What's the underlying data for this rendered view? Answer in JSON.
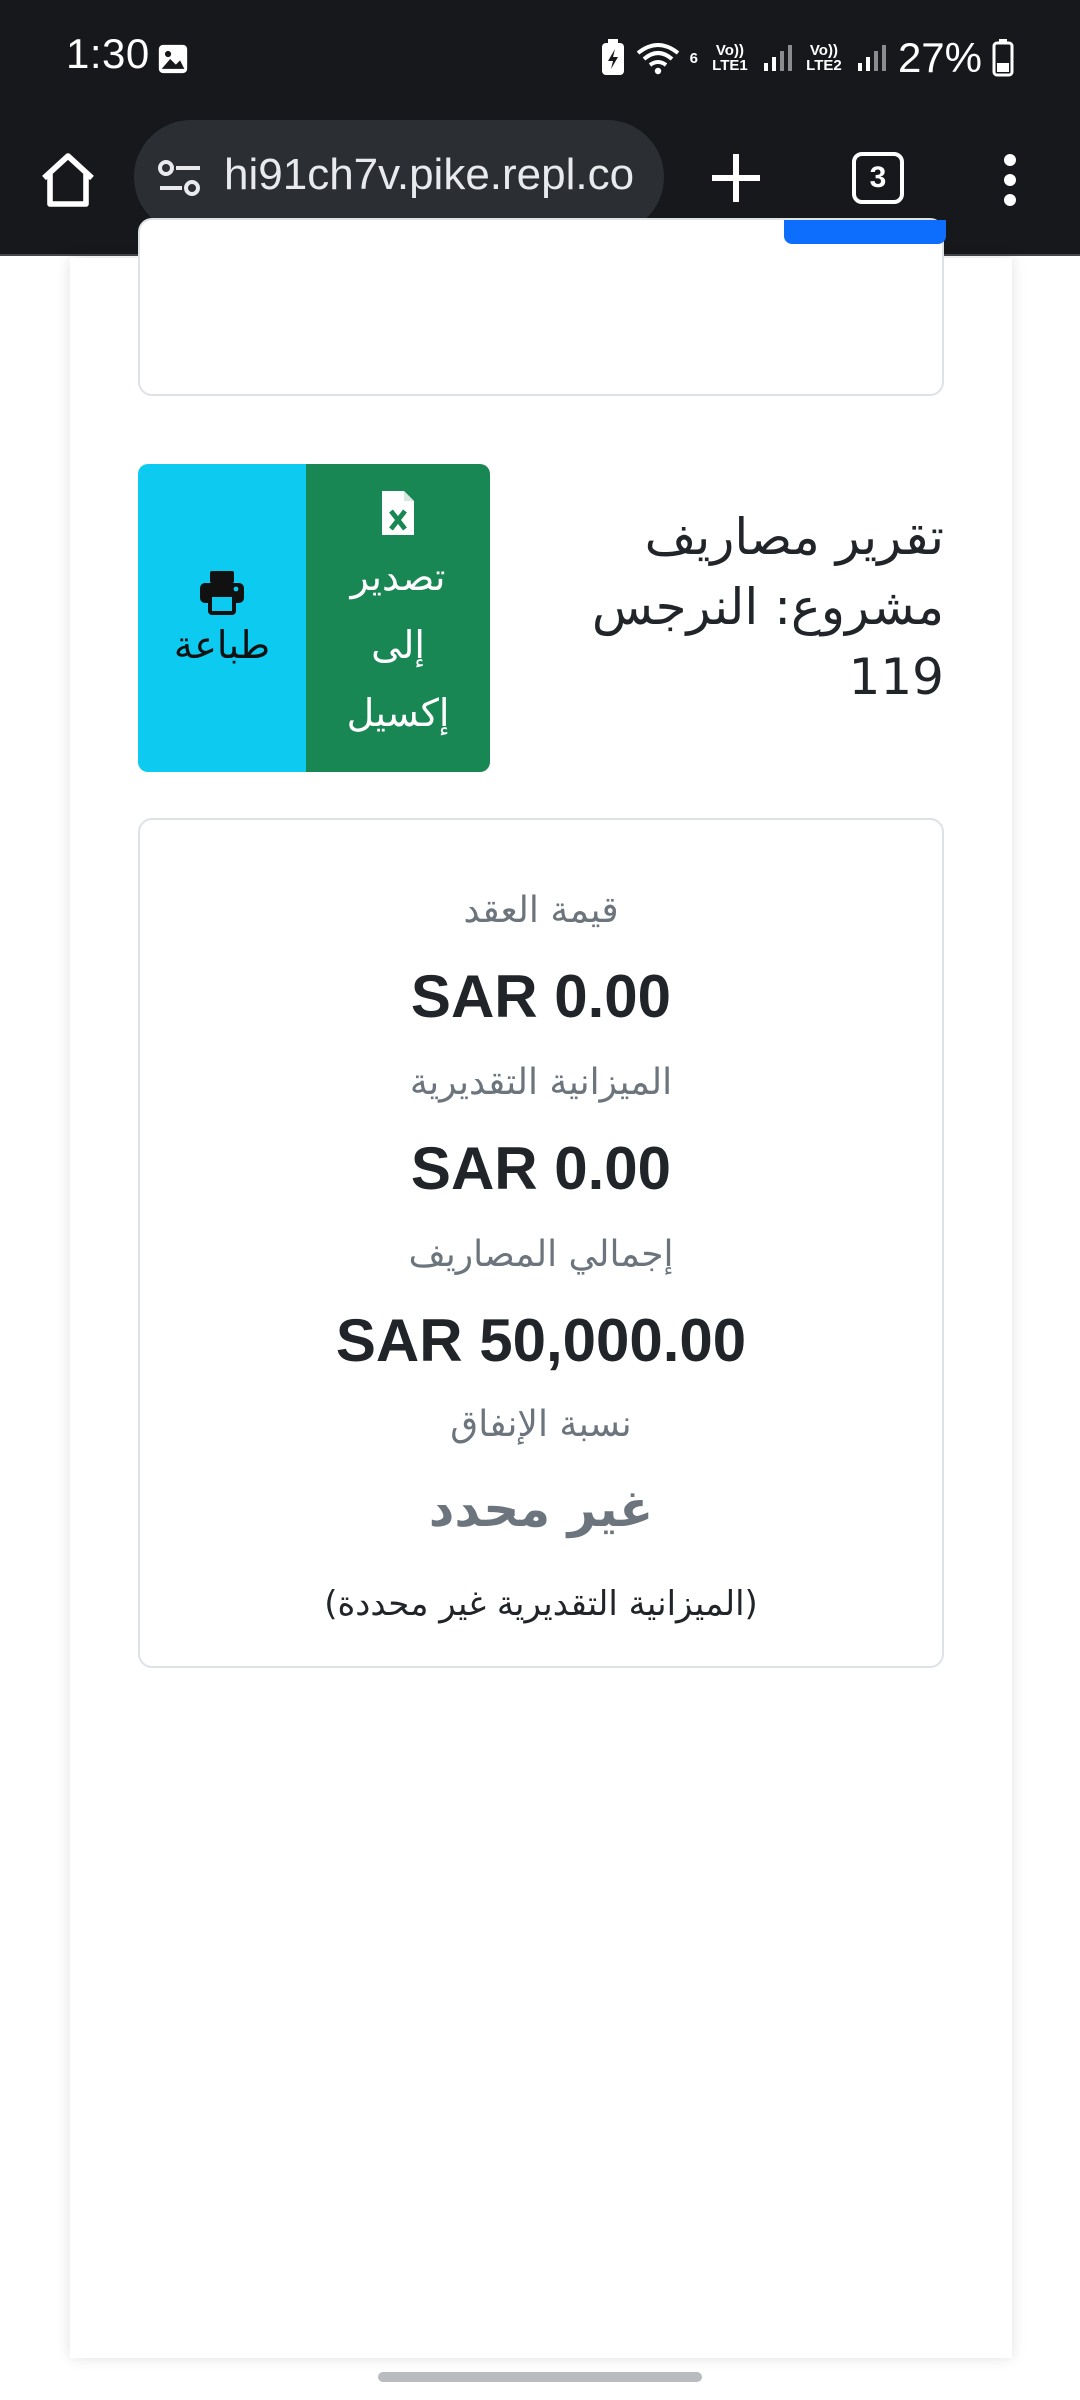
{
  "status_bar": {
    "time": "1:30",
    "battery_percent": "27%",
    "sim1_label": "Vo)) LTE1",
    "sim2_label": "Vo)) LTE2",
    "wifi_label": "6"
  },
  "browser": {
    "url": "hi91ch7v.pike.repl.co",
    "tab_count": "3"
  },
  "report": {
    "title_line1": "تقرير مصاريف",
    "title_line2": "مشروع: النرجس",
    "title_line3": "119",
    "print_label": "طباعة",
    "excel_line1": "تصدير",
    "excel_line2": "إلى",
    "excel_line3": "إكسيل"
  },
  "summary": {
    "contract_label": "قيمة العقد",
    "contract_value": "SAR 0.00",
    "budget_label": "الميزانية التقديرية",
    "budget_value": "SAR 0.00",
    "expenses_label": "إجمالي المصاريف",
    "expenses_value": "SAR 50,000.00",
    "spending_label": "نسبة الإنفاق",
    "spending_value": "غير محدد",
    "spending_note": "(الميزانية التقديرية غير محددة)"
  },
  "colors": {
    "print_button": "#0dcaf0",
    "excel_button": "#198754",
    "primary": "#0d6efd"
  }
}
